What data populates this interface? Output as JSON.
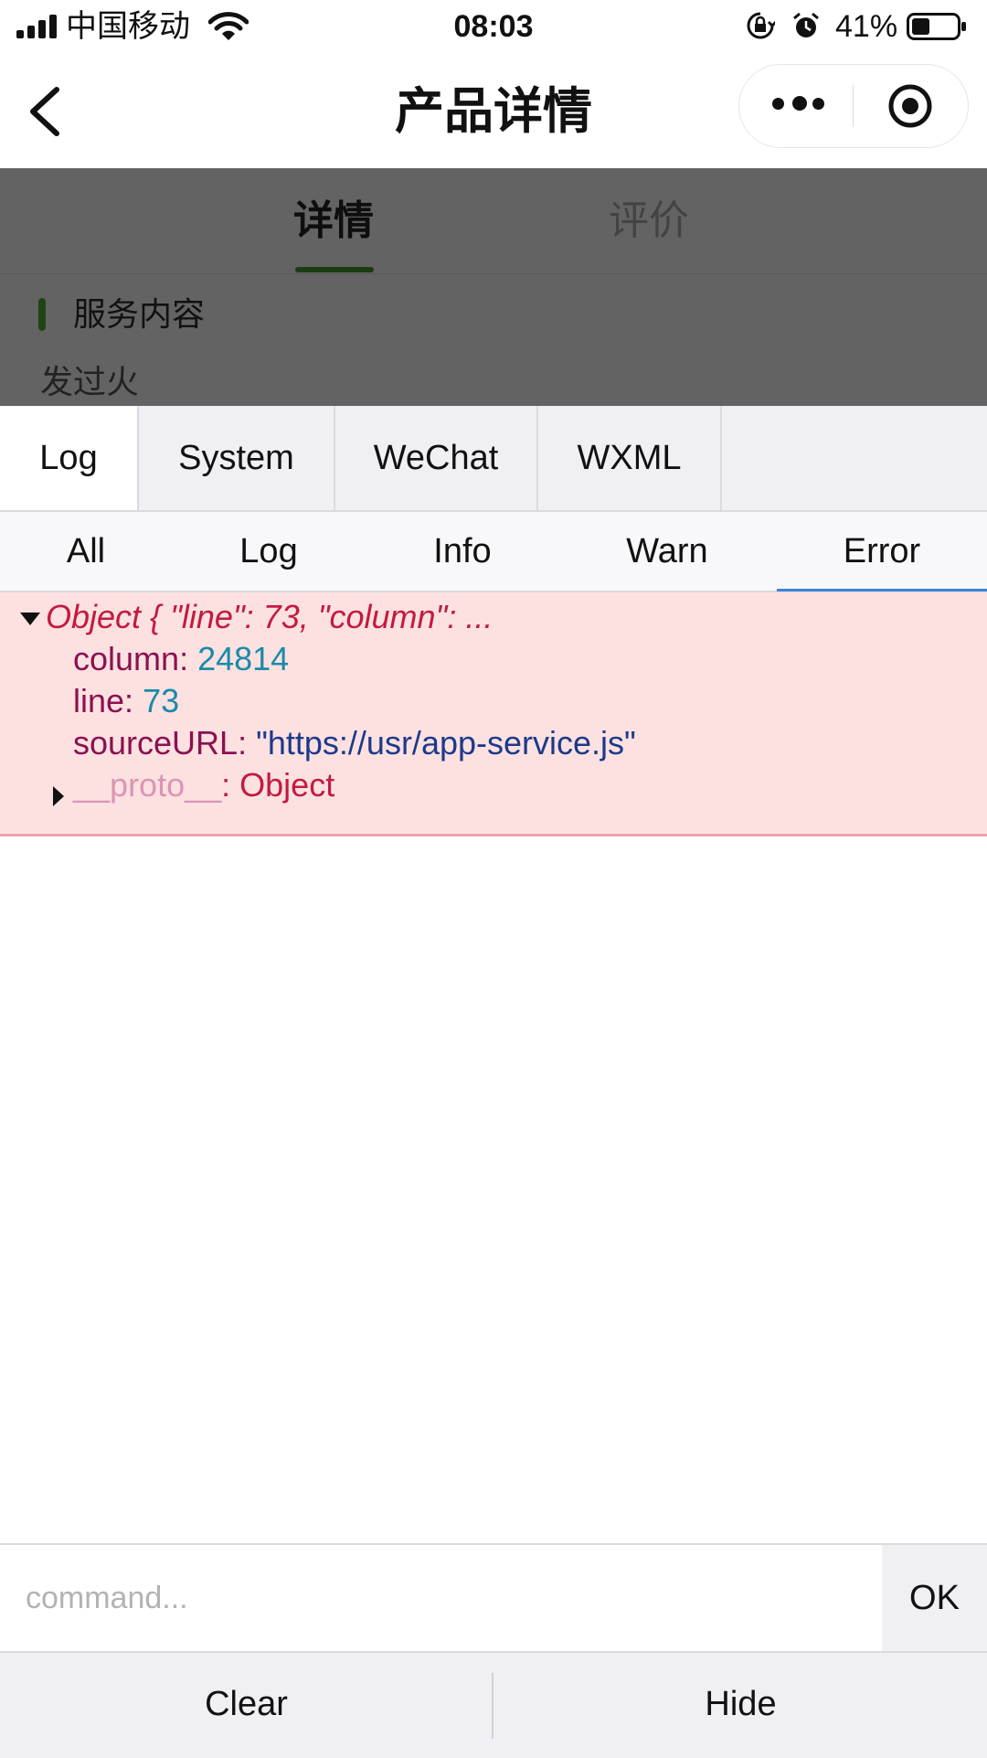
{
  "status_bar": {
    "carrier": "中国移动",
    "time": "08:03",
    "battery": "41%",
    "battery_level": 0.41
  },
  "nav": {
    "title": "产品详情"
  },
  "page": {
    "tabs": [
      "详情",
      "评价"
    ],
    "active_tab": "详情",
    "section_title": "服务内容",
    "section_content": "发过火",
    "accent_color": "#1f4412"
  },
  "console": {
    "tabs": [
      "Log",
      "System",
      "WeChat",
      "WXML"
    ],
    "active_tab": "Log",
    "filters": [
      "All",
      "Log",
      "Info",
      "Warn",
      "Error"
    ],
    "active_filter": "Error",
    "entry": {
      "summary": "Object { \"line\": 73, \"column\": ...",
      "props": [
        {
          "key": "column",
          "value": "24814"
        },
        {
          "key": "line",
          "value": "73"
        },
        {
          "key": "sourceURL",
          "value": "\"https://usr/app-service.js\""
        }
      ],
      "proto_key": "__proto__",
      "proto_value": ": Object"
    },
    "command_placeholder": "command...",
    "ok_label": "OK",
    "clear_label": "Clear",
    "hide_label": "Hide"
  }
}
